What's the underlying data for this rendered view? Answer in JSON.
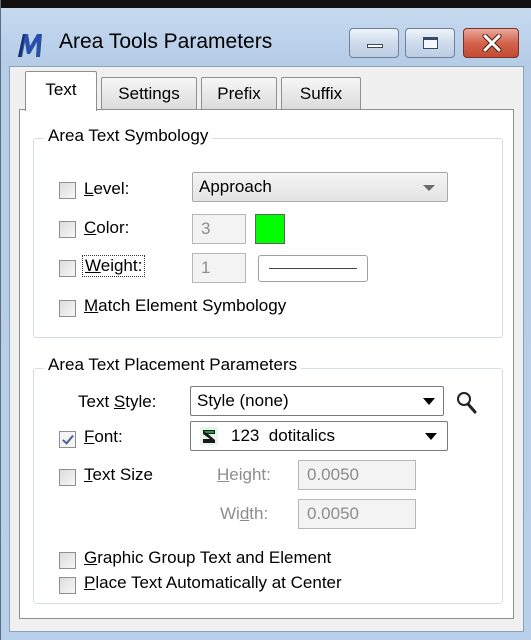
{
  "window": {
    "title": "Area Tools Parameters",
    "minimize_icon": "minimize-icon",
    "maximize_icon": "maximize-icon",
    "close_icon": "close-icon",
    "close_color": "#c9503a"
  },
  "tabs": [
    {
      "label": "Text",
      "active": true
    },
    {
      "label": "Settings",
      "active": false
    },
    {
      "label": "Prefix",
      "active": false
    },
    {
      "label": "Suffix",
      "active": false
    }
  ],
  "symbology": {
    "group_title": "Area Text Symbology",
    "level": {
      "label": "Level:",
      "checked": false,
      "value": "Approach"
    },
    "color": {
      "label": "Color:",
      "checked": false,
      "value": "3",
      "swatch": "#00ff00"
    },
    "weight": {
      "label": "Weight:",
      "checked": false,
      "value": "1"
    },
    "match": {
      "label": "Match Element Symbology",
      "checked": false
    }
  },
  "placement": {
    "group_title": "Area Text Placement Parameters",
    "text_style": {
      "label": "Text Style:",
      "value": "Style (none)"
    },
    "font": {
      "label": "Font:",
      "checked": true,
      "value": "123  dotitalics",
      "icon": "font-type-icon"
    },
    "text_size": {
      "label": "Text Size",
      "checked": false,
      "height_label": "Height:",
      "height_value": "0.0050",
      "width_label": "Width:",
      "width_value": "0.0050"
    },
    "graphic_group": {
      "label": "Graphic Group Text and Element",
      "checked": false
    },
    "place_center": {
      "label": "Place Text Automatically at Center",
      "checked": false
    }
  }
}
